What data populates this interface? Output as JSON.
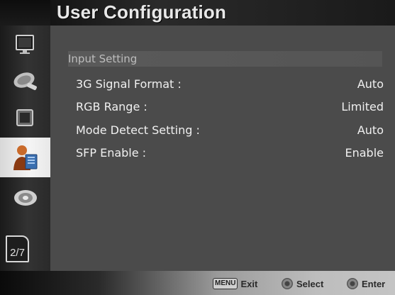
{
  "header": {
    "title": "User Configuration"
  },
  "sidebar": {
    "items": [
      {
        "name": "picture-monitor",
        "icon": "monitor-icon"
      },
      {
        "name": "satellite-dish",
        "icon": "dish-icon"
      },
      {
        "name": "display-setting",
        "icon": "display-icon"
      },
      {
        "name": "user-configuration",
        "icon": "user-config-icon",
        "active": true
      },
      {
        "name": "system",
        "icon": "disc-icon"
      }
    ],
    "page_indicator": "2/7"
  },
  "main": {
    "section_title": "Input Setting",
    "settings": [
      {
        "label": "3G Signal Format :",
        "value": "Auto"
      },
      {
        "label": "RGB Range :",
        "value": "Limited"
      },
      {
        "label": "Mode Detect Setting :",
        "value": "Auto"
      },
      {
        "label": "SFP Enable :",
        "value": "Enable"
      }
    ]
  },
  "footer": {
    "menu_key": "MENU",
    "exit_label": "Exit",
    "select_label": "Select",
    "enter_label": "Enter"
  }
}
